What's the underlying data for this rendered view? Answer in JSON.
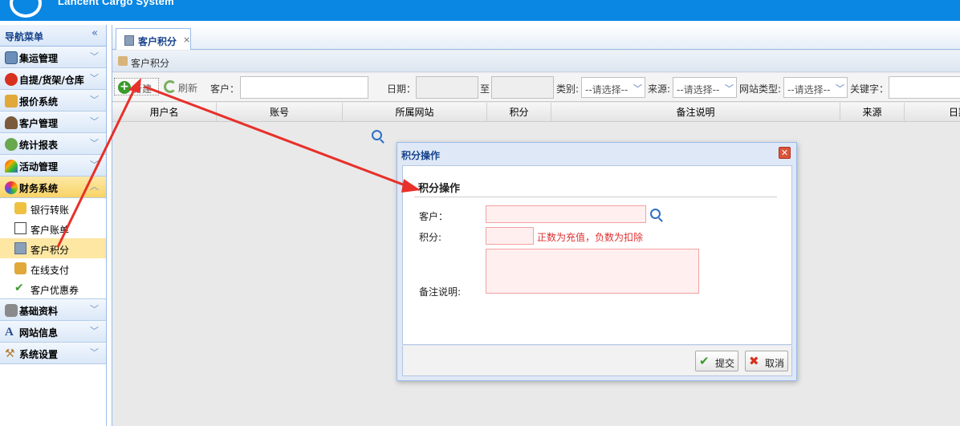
{
  "app": {
    "brand_text": "Lancent Cargo System",
    "accent_color": "#0a86e3"
  },
  "sidebar": {
    "title": "导航菜单",
    "collapse_icon": "double-chevron-left-icon",
    "items": [
      {
        "label": "集运管理",
        "icon": "monitor-icon"
      },
      {
        "label": "自提/货架/仓库",
        "icon": "red-circle-icon"
      },
      {
        "label": "报价系统",
        "icon": "coins-icon"
      },
      {
        "label": "客户管理",
        "icon": "user-icon"
      },
      {
        "label": "统计报表",
        "icon": "globe-icon"
      },
      {
        "label": "活动管理",
        "icon": "rainbow-icon"
      },
      {
        "label": "财务系统",
        "icon": "color-wheel-icon",
        "expanded": true
      }
    ],
    "finance_sub": [
      {
        "label": "银行转账",
        "icon": "lock-icon"
      },
      {
        "label": "客户账单",
        "icon": "document-icon"
      },
      {
        "label": "客户积分",
        "icon": "calculator-icon",
        "selected": true
      },
      {
        "label": "在线支付",
        "icon": "coins-icon"
      },
      {
        "label": "客户优惠券",
        "icon": "checkmark-icon"
      }
    ],
    "items_after": [
      {
        "label": "基础资料",
        "icon": "database-icon"
      },
      {
        "label": "网站信息",
        "icon": "font-icon"
      },
      {
        "label": "系统设置",
        "icon": "wrench-icon"
      }
    ]
  },
  "tabs": [
    {
      "label": "客户积分",
      "close": "×"
    }
  ],
  "panel": {
    "title": "客户积分"
  },
  "toolbar": {
    "new_label": "新建",
    "refresh_label": "刷新",
    "customer_label": "客户：",
    "date_label": "日期：",
    "to_label": "至",
    "category_label": "类别:",
    "category_value": "--请选择--",
    "source_label": "来源:",
    "source_value": "--请选择--",
    "site_type_label": "网站类型:",
    "site_type_value": "--请选择--",
    "keyword_label": "关键字："
  },
  "grid": {
    "columns": [
      "用户名",
      "账号",
      "所属网站",
      "积分",
      "备注说明",
      "来源",
      "日期"
    ]
  },
  "dialog": {
    "title": "积分操作",
    "section_title": "积分操作",
    "customer_label": "客户：",
    "points_label": "积分:",
    "points_hint": "正数为充值，负数为扣除",
    "remark_label": "备注说明:",
    "submit_label": "提交",
    "cancel_label": "取消",
    "close_icon": "close-icon"
  }
}
